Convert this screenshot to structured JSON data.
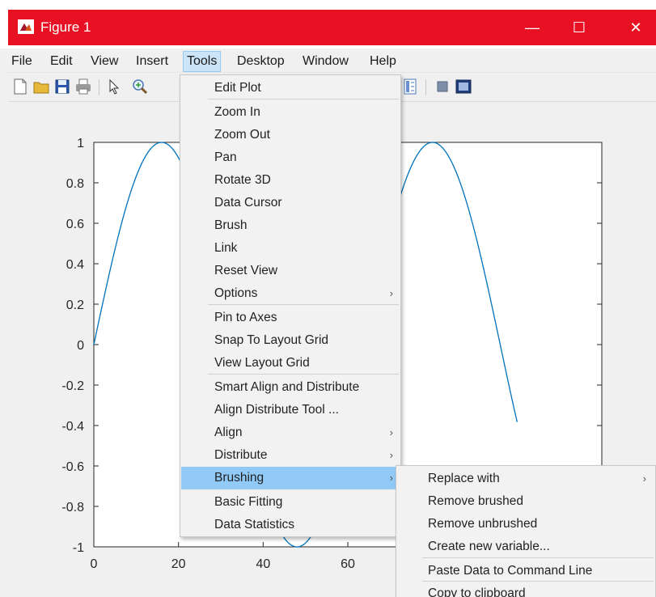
{
  "window": {
    "title": "Figure 1",
    "minimize_glyph": "—",
    "maximize_glyph": "☐",
    "close_glyph": "✕",
    "accent_color": "#e81123"
  },
  "menubar": {
    "items": [
      "File",
      "Edit",
      "View",
      "Insert",
      "Tools",
      "Desktop",
      "Window",
      "Help"
    ],
    "active": "Tools"
  },
  "toolbar": {
    "icons": [
      "new-figure-icon",
      "open-file-icon",
      "save-icon",
      "print-icon",
      "pointer-icon",
      "zoom-in-icon",
      "colorbar-icon",
      "hide-plot-tools-icon",
      "show-plot-tools-icon"
    ]
  },
  "tools_menu": {
    "items": [
      {
        "label": "Edit Plot"
      },
      {
        "label": "Zoom In"
      },
      {
        "label": "Zoom Out"
      },
      {
        "label": "Pan"
      },
      {
        "label": "Rotate 3D"
      },
      {
        "label": "Data Cursor"
      },
      {
        "label": "Brush"
      },
      {
        "label": "Link"
      },
      {
        "label": "Reset View"
      },
      {
        "label": "Options",
        "submenu": true
      },
      {
        "label": "Pin to Axes"
      },
      {
        "label": "Snap To Layout Grid"
      },
      {
        "label": "View Layout Grid"
      },
      {
        "label": "Smart Align and Distribute"
      },
      {
        "label": "Align Distribute Tool ..."
      },
      {
        "label": "Align",
        "submenu": true
      },
      {
        "label": "Distribute",
        "submenu": true
      },
      {
        "label": "Brushing",
        "submenu": true,
        "highlighted": true
      },
      {
        "label": "Basic Fitting"
      },
      {
        "label": "Data Statistics"
      }
    ],
    "submenu_glyph": "›"
  },
  "brushing_submenu": {
    "items": [
      {
        "label": "Replace with",
        "submenu": true
      },
      {
        "label": "Remove brushed"
      },
      {
        "label": "Remove unbrushed"
      },
      {
        "label": "Create new variable..."
      },
      {
        "label": "Paste Data to Command Line"
      },
      {
        "label": "Copy to clipboard"
      }
    ]
  },
  "chart_data": {
    "type": "line",
    "title": "",
    "xlabel": "",
    "ylabel": "",
    "xlim": [
      0,
      120
    ],
    "ylim": [
      -1,
      1
    ],
    "xticks": [
      0,
      20,
      40,
      60
    ],
    "yticks": [
      1,
      0.8,
      0.6,
      0.4,
      0.2,
      0,
      -0.2,
      -0.4,
      -0.6,
      -0.8,
      -1
    ],
    "series": [
      {
        "function": "sin(pi*x/32)",
        "x_range": [
          0,
          100
        ],
        "color": "#0072bd"
      }
    ]
  }
}
